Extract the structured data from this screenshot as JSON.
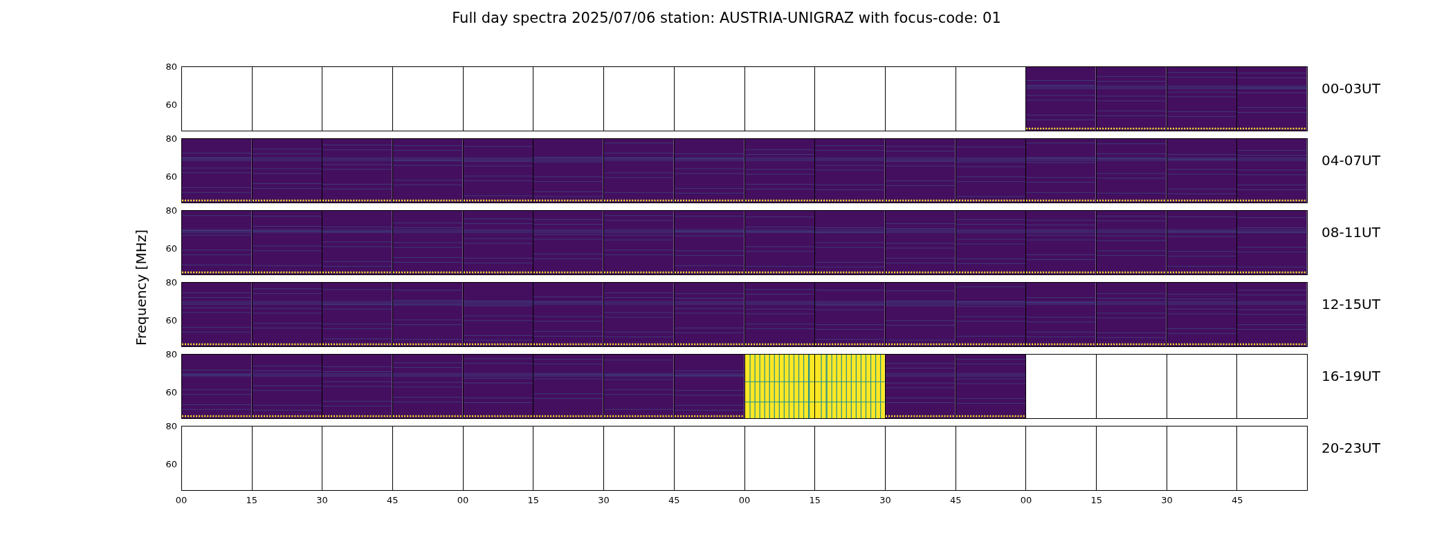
{
  "title": "Full day spectra 2025/07/06 station: AUSTRIA-UNIGRAZ with focus-code: 01",
  "ylabel": "Frequency [MHz]",
  "rows": [
    {
      "label": "00-03UT",
      "y_ticks": [
        "80",
        "60"
      ],
      "panels": [
        {
          "kind": "empty"
        },
        {
          "kind": "empty"
        },
        {
          "kind": "empty"
        },
        {
          "kind": "empty"
        },
        {
          "kind": "empty"
        },
        {
          "kind": "empty"
        },
        {
          "kind": "empty"
        },
        {
          "kind": "empty"
        },
        {
          "kind": "empty"
        },
        {
          "kind": "empty"
        },
        {
          "kind": "empty"
        },
        {
          "kind": "empty"
        },
        {
          "kind": "spectrum"
        },
        {
          "kind": "spectrum"
        },
        {
          "kind": "spectrum"
        },
        {
          "kind": "spectrum"
        }
      ]
    },
    {
      "label": "04-07UT",
      "y_ticks": [
        "80",
        "60"
      ],
      "panels": [
        {
          "kind": "spectrum"
        },
        {
          "kind": "spectrum"
        },
        {
          "kind": "spectrum"
        },
        {
          "kind": "spectrum"
        },
        {
          "kind": "spectrum"
        },
        {
          "kind": "spectrum"
        },
        {
          "kind": "spectrum"
        },
        {
          "kind": "spectrum"
        },
        {
          "kind": "spectrum"
        },
        {
          "kind": "spectrum"
        },
        {
          "kind": "spectrum"
        },
        {
          "kind": "spectrum"
        },
        {
          "kind": "spectrum"
        },
        {
          "kind": "spectrum"
        },
        {
          "kind": "spectrum"
        },
        {
          "kind": "spectrum"
        }
      ]
    },
    {
      "label": "08-11UT",
      "y_ticks": [
        "80",
        "60"
      ],
      "panels": [
        {
          "kind": "spectrum"
        },
        {
          "kind": "spectrum"
        },
        {
          "kind": "spectrum"
        },
        {
          "kind": "spectrum"
        },
        {
          "kind": "spectrum"
        },
        {
          "kind": "spectrum"
        },
        {
          "kind": "spectrum"
        },
        {
          "kind": "spectrum"
        },
        {
          "kind": "spectrum"
        },
        {
          "kind": "spectrum"
        },
        {
          "kind": "spectrum"
        },
        {
          "kind": "spectrum"
        },
        {
          "kind": "spectrum"
        },
        {
          "kind": "spectrum"
        },
        {
          "kind": "spectrum"
        },
        {
          "kind": "spectrum"
        }
      ]
    },
    {
      "label": "12-15UT",
      "y_ticks": [
        "80",
        "60"
      ],
      "panels": [
        {
          "kind": "spectrum"
        },
        {
          "kind": "spectrum"
        },
        {
          "kind": "spectrum"
        },
        {
          "kind": "spectrum"
        },
        {
          "kind": "spectrum"
        },
        {
          "kind": "spectrum"
        },
        {
          "kind": "spectrum"
        },
        {
          "kind": "spectrum"
        },
        {
          "kind": "spectrum"
        },
        {
          "kind": "spectrum"
        },
        {
          "kind": "spectrum"
        },
        {
          "kind": "spectrum"
        },
        {
          "kind": "spectrum"
        },
        {
          "kind": "spectrum"
        },
        {
          "kind": "spectrum"
        },
        {
          "kind": "spectrum"
        }
      ]
    },
    {
      "label": "16-19UT",
      "y_ticks": [
        "80",
        "60"
      ],
      "panels": [
        {
          "kind": "spectrum"
        },
        {
          "kind": "spectrum"
        },
        {
          "kind": "spectrum"
        },
        {
          "kind": "spectrum"
        },
        {
          "kind": "spectrum"
        },
        {
          "kind": "spectrum"
        },
        {
          "kind": "spectrum"
        },
        {
          "kind": "spectrum"
        },
        {
          "kind": "burst"
        },
        {
          "kind": "burst"
        },
        {
          "kind": "spectrum"
        },
        {
          "kind": "spectrum"
        },
        {
          "kind": "empty"
        },
        {
          "kind": "empty"
        },
        {
          "kind": "empty"
        },
        {
          "kind": "empty"
        }
      ]
    },
    {
      "label": "20-23UT",
      "y_ticks": [
        "80",
        "60"
      ],
      "panels": [
        {
          "kind": "empty"
        },
        {
          "kind": "empty"
        },
        {
          "kind": "empty"
        },
        {
          "kind": "empty"
        },
        {
          "kind": "empty"
        },
        {
          "kind": "empty"
        },
        {
          "kind": "empty"
        },
        {
          "kind": "empty"
        },
        {
          "kind": "empty"
        },
        {
          "kind": "empty"
        },
        {
          "kind": "empty"
        },
        {
          "kind": "empty"
        },
        {
          "kind": "empty"
        },
        {
          "kind": "empty"
        },
        {
          "kind": "empty"
        },
        {
          "kind": "empty"
        }
      ]
    }
  ],
  "x_ticks": [
    "00",
    "15",
    "30",
    "45",
    "00",
    "15",
    "30",
    "45",
    "00",
    "15",
    "30",
    "45",
    "00",
    "15",
    "30",
    "45"
  ]
}
